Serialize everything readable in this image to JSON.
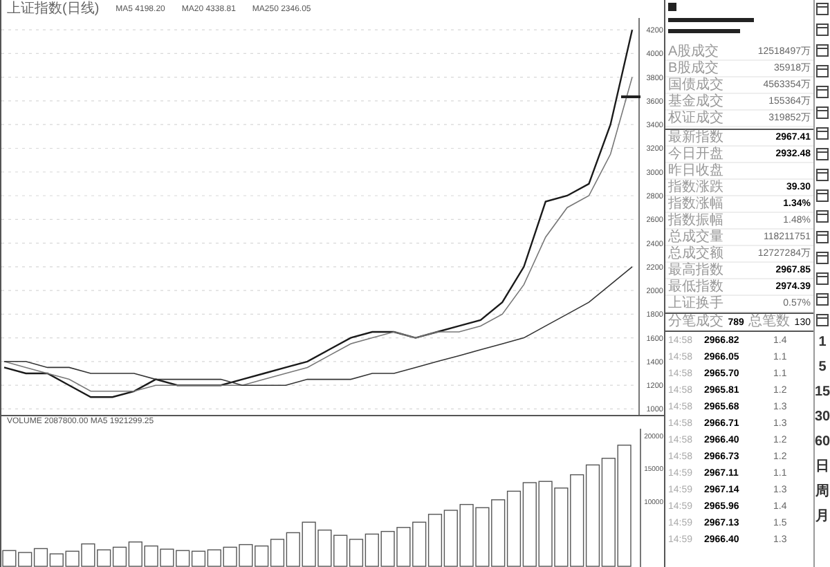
{
  "chart_header": {
    "title": "上证指数(日线)",
    "indicators": [
      "MA5 4198.20",
      "MA20 4338.81",
      "MA250 2346.05"
    ]
  },
  "price_chart": {
    "chart_data": {
      "type": "line",
      "grid": true,
      "ylim": [
        950,
        4300
      ],
      "yticks": [
        1000,
        1200,
        1400,
        1600,
        1800,
        2000,
        2200,
        2400,
        2600,
        2800,
        3000,
        3200,
        3400,
        3600,
        3800,
        4000,
        4200
      ],
      "series": [
        {
          "color": "#1a1a1a",
          "values": [
            1350,
            1300,
            1300,
            1200,
            1100,
            1100,
            1150,
            1250,
            1200,
            1200,
            1200,
            1250,
            1300,
            1350,
            1400,
            1500,
            1600,
            1650,
            1650,
            1600,
            1650,
            1700,
            1750,
            1900,
            2200,
            2750,
            2800,
            2900,
            3400,
            4200
          ]
        },
        {
          "color": "#777777",
          "values": [
            1400,
            1350,
            1300,
            1250,
            1150,
            1150,
            1150,
            1200,
            1200,
            1200,
            1200,
            1200,
            1250,
            1300,
            1350,
            1450,
            1550,
            1600,
            1650,
            1600,
            1650,
            1650,
            1700,
            1800,
            2050,
            2450,
            2700,
            2800,
            3150,
            3800
          ]
        },
        {
          "color": "#333333",
          "values": [
            1400,
            1400,
            1350,
            1350,
            1300,
            1300,
            1300,
            1250,
            1250,
            1250,
            1250,
            1200,
            1200,
            1200,
            1250,
            1250,
            1250,
            1300,
            1300,
            1350,
            1400,
            1450,
            1500,
            1550,
            1600,
            1700,
            1800,
            1900,
            2050,
            2200
          ]
        }
      ]
    }
  },
  "volume_header": "VOLUME 2087800.00 MA5 1921299.25",
  "volume_axis_labels": [
    "20000",
    "15000",
    "10000"
  ],
  "quote_panel": {
    "group_1": [
      {
        "label": "A股成交",
        "value": "12518497万"
      },
      {
        "label": "B股成交",
        "value": "35918万"
      },
      {
        "label": "国债成交",
        "value": "4563354万"
      },
      {
        "label": "基金成交",
        "value": "155364万"
      },
      {
        "label": "权证成交",
        "value": "319852万"
      }
    ],
    "group_2": [
      {
        "label": "最新指数",
        "value": "2967.41",
        "bold": true
      },
      {
        "label": "今日开盘",
        "value": "2932.48",
        "bold": true
      },
      {
        "label": "昨日收盘"
      },
      {
        "label": "指数涨跌",
        "value": "39.30",
        "bold": true
      },
      {
        "label": "指数涨幅",
        "value": "1.34%",
        "bold": true
      },
      {
        "label": "指数振幅",
        "value": "1.48%",
        "bold": false
      },
      {
        "label": "总成交量",
        "value": "118211751",
        "bold": false
      },
      {
        "label": "总成交额",
        "value": "12727284万",
        "bold": false
      },
      {
        "label": "最高指数",
        "value": "2967.85",
        "bold": true
      },
      {
        "label": "最低指数",
        "value": "2974.39",
        "bold": true
      },
      {
        "label": "上证换手",
        "value": "0.57%",
        "bold": false
      }
    ]
  },
  "ticks": {
    "header": [
      "分笔成交",
      "789",
      "总笔数",
      "130"
    ],
    "rows": [
      {
        "time": "14:58",
        "price": "2966.82",
        "volume": "1.4"
      },
      {
        "time": "14:58",
        "price": "2966.05",
        "volume": "1.1"
      },
      {
        "time": "14:58",
        "price": "2965.70",
        "volume": "1.1"
      },
      {
        "time": "14:58",
        "price": "2965.81",
        "volume": "1.2"
      },
      {
        "time": "14:58",
        "price": "2965.68",
        "volume": "1.3"
      },
      {
        "time": "14:58",
        "price": "2966.71",
        "volume": "1.3"
      },
      {
        "time": "14:58",
        "price": "2966.40",
        "volume": "1.2"
      },
      {
        "time": "14:58",
        "price": "2966.73",
        "volume": "1.2"
      },
      {
        "time": "14:59",
        "price": "2967.11",
        "volume": "1.1"
      },
      {
        "time": "14:59",
        "price": "2967.14",
        "volume": "1.3"
      },
      {
        "time": "14:59",
        "price": "2965.96",
        "volume": "1.4"
      },
      {
        "time": "14:59",
        "price": "2967.13",
        "volume": "1.5"
      },
      {
        "time": "14:59",
        "price": "2966.40",
        "volume": "1.3"
      }
    ]
  },
  "toolbar": {
    "periods": [
      "1",
      "5",
      "15",
      "30",
      "60",
      "日",
      "周",
      "月"
    ]
  }
}
